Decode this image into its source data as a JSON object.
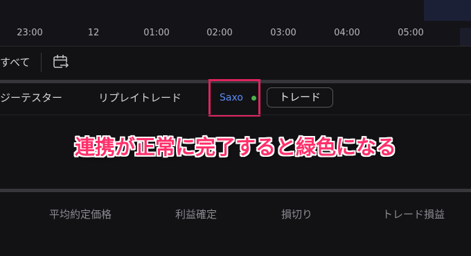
{
  "chart": {
    "time_axis": [
      "23:00",
      "12",
      "01:00",
      "02:00",
      "03:00",
      "04:00",
      "05:00"
    ]
  },
  "toolbar": {
    "all_label": "すべて",
    "calendar_icon": "calendar-arrow-icon"
  },
  "tabs": {
    "strategy_tester": "ジーテスター",
    "replay_trade": "リプレイトレード",
    "broker": "Saxo",
    "broker_status_color": "#4caf50",
    "trade_button": "トレード"
  },
  "annotation": {
    "text": "連携が正常に完了すると緑色になる",
    "color": "#ff2f6a"
  },
  "table": {
    "headers": [
      "平均約定価格",
      "利益確定",
      "損切り",
      "トレード損益"
    ]
  }
}
